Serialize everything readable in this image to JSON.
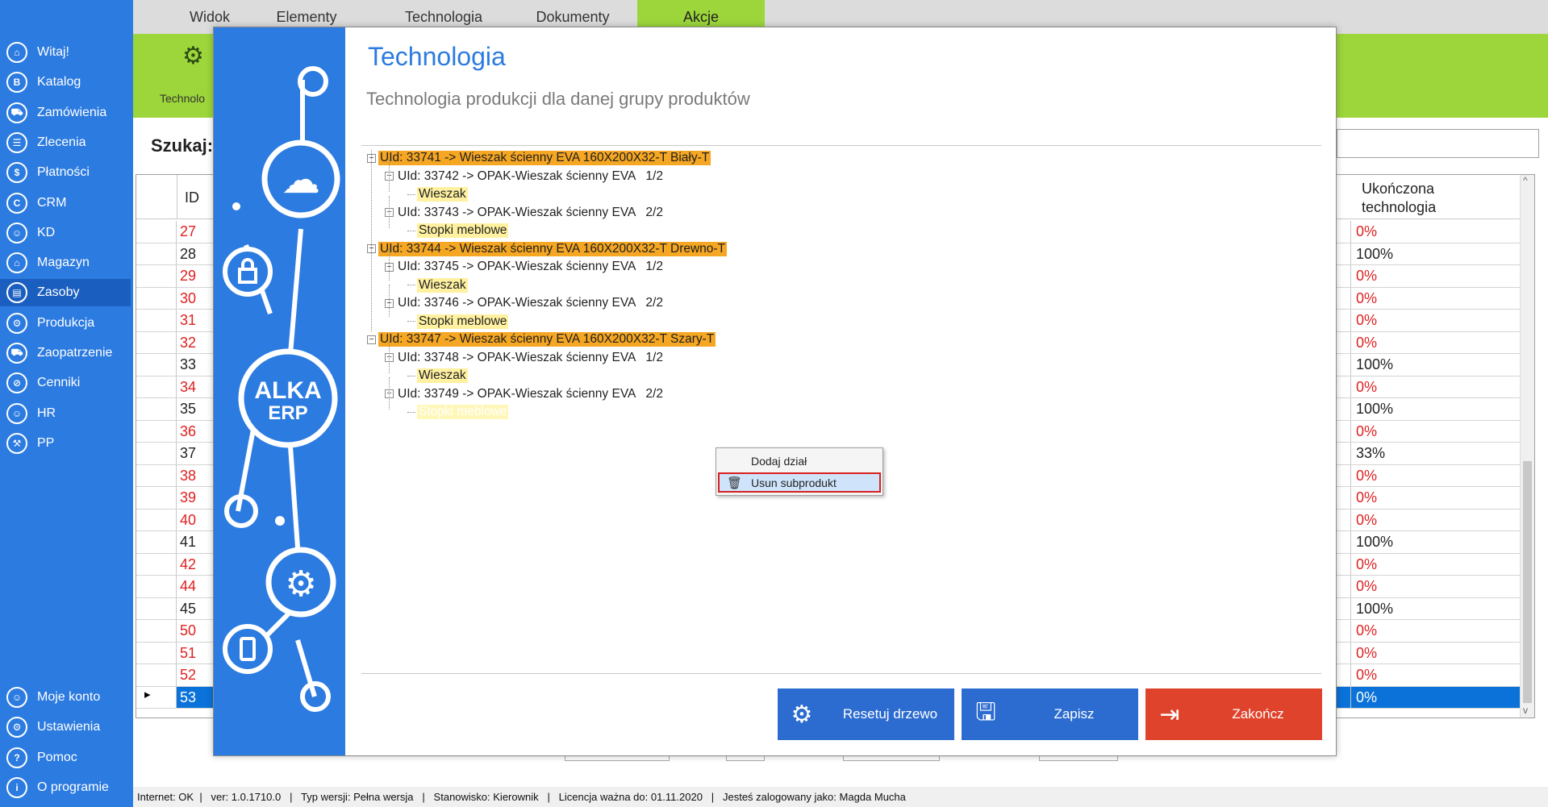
{
  "tabs": [
    {
      "label": "Widok",
      "active": false
    },
    {
      "label": "Elementy",
      "active": false
    },
    {
      "label": "Technologia",
      "active": false
    },
    {
      "label": "Dokumenty",
      "active": false
    },
    {
      "label": "Akcje",
      "active": true
    }
  ],
  "ribbon": {
    "label": "Technolo",
    "icon": "gears-icon"
  },
  "sidebar": {
    "items": [
      {
        "label": "Witaj!",
        "icon": "home-icon"
      },
      {
        "label": "Katalog",
        "icon": "book-icon"
      },
      {
        "label": "Zamówienia",
        "icon": "cart-icon"
      },
      {
        "label": "Zlecenia",
        "icon": "list-icon"
      },
      {
        "label": "Płatności",
        "icon": "dollar-icon"
      },
      {
        "label": "CRM",
        "icon": "crm-icon"
      },
      {
        "label": "KD",
        "icon": "user-icon"
      },
      {
        "label": "Magazyn",
        "icon": "warehouse-icon"
      },
      {
        "label": "Zasoby",
        "icon": "resources-icon",
        "active": true
      },
      {
        "label": "Produkcja",
        "icon": "production-icon"
      },
      {
        "label": "Zaopatrzenie",
        "icon": "truck-icon"
      },
      {
        "label": "Cenniki",
        "icon": "tag-icon"
      },
      {
        "label": "HR",
        "icon": "hr-icon"
      },
      {
        "label": "PP",
        "icon": "factory-icon"
      }
    ],
    "bottom_items": [
      {
        "label": "Moje konto",
        "icon": "account-icon"
      },
      {
        "label": "Ustawienia",
        "icon": "settings-icon"
      },
      {
        "label": "Pomoc",
        "icon": "help-icon"
      },
      {
        "label": "O programie",
        "icon": "info-icon"
      }
    ]
  },
  "search": {
    "label": "Szukaj:"
  },
  "grid": {
    "header_id": "ID",
    "header_tech": "Ukończona\ntechnologia",
    "rows": [
      {
        "id": "27",
        "tech": "0%",
        "red": true
      },
      {
        "id": "28",
        "tech": "100%",
        "red": false
      },
      {
        "id": "29",
        "tech": "0%",
        "red": true
      },
      {
        "id": "30",
        "tech": "0%",
        "red": true
      },
      {
        "id": "31",
        "tech": "0%",
        "red": true
      },
      {
        "id": "32",
        "tech": "0%",
        "red": true
      },
      {
        "id": "33",
        "tech": "100%",
        "red": false
      },
      {
        "id": "34",
        "tech": "0%",
        "red": true
      },
      {
        "id": "35",
        "tech": "100%",
        "red": false
      },
      {
        "id": "36",
        "tech": "0%",
        "red": true
      },
      {
        "id": "37",
        "tech": "33%",
        "red": false
      },
      {
        "id": "38",
        "tech": "0%",
        "red": true
      },
      {
        "id": "39",
        "tech": "0%",
        "red": true
      },
      {
        "id": "40",
        "tech": "0%",
        "red": true
      },
      {
        "id": "41",
        "tech": "100%",
        "red": false
      },
      {
        "id": "42",
        "tech": "0%",
        "red": true
      },
      {
        "id": "44",
        "tech": "0%",
        "red": true
      },
      {
        "id": "45",
        "tech": "100%",
        "red": false
      },
      {
        "id": "50",
        "tech": "0%",
        "red": true
      },
      {
        "id": "51",
        "tech": "0%",
        "red": true
      },
      {
        "id": "52",
        "tech": "0%",
        "red": true
      },
      {
        "id": "53",
        "tech": "0%",
        "red": false,
        "selected": true
      }
    ]
  },
  "dialog": {
    "title": "Technologia",
    "subtitle": "Technologia produkcji dla danej grupy produktów",
    "tree": [
      {
        "level": 0,
        "text": "UId: 33741 -> Wieszak ścienny EVA 160X200X32-T Biały-T"
      },
      {
        "level": 1,
        "text": "UId: 33742 -> OPAK-Wieszak ścienny EVA   1/2"
      },
      {
        "level": 2,
        "text": "Wieszak"
      },
      {
        "level": 1,
        "text": "UId: 33743 -> OPAK-Wieszak ścienny EVA   2/2"
      },
      {
        "level": 2,
        "text": "Stopki meblowe"
      },
      {
        "level": 0,
        "text": "UId: 33744 -> Wieszak ścienny EVA 160X200X32-T Drewno-T"
      },
      {
        "level": 1,
        "text": "UId: 33745 -> OPAK-Wieszak ścienny EVA   1/2"
      },
      {
        "level": 2,
        "text": "Wieszak"
      },
      {
        "level": 1,
        "text": "UId: 33746 -> OPAK-Wieszak ścienny EVA   2/2"
      },
      {
        "level": 2,
        "text": "Stopki meblowe"
      },
      {
        "level": 0,
        "text": "UId: 33747 -> Wieszak ścienny EVA 160X200X32-T Szary-T"
      },
      {
        "level": 1,
        "text": "UId: 33748 -> OPAK-Wieszak ścienny EVA   1/2"
      },
      {
        "level": 2,
        "text": "Wieszak"
      },
      {
        "level": 1,
        "text": "UId: 33749 -> OPAK-Wieszak ścienny EVA   2/2"
      },
      {
        "level": 2,
        "text": "Stopki meblowe",
        "ghost": true
      }
    ],
    "context_menu": {
      "add_label": "Dodaj dział",
      "remove_label": "Usun subprodukt"
    },
    "buttons": {
      "reset": "Resetuj drzewo",
      "save": "Zapisz",
      "close": "Zakończ"
    },
    "logo": {
      "line1": "ALKA",
      "line2": "ERP"
    }
  },
  "status": "Internet: OK  |   ver: 1.0.1710.0   |   Typ wersji: Pełna wersja   |   Stanowisko: Kierownik   |   Licencja ważna do: 01.11.2020   |   Jesteś zalogowany jako: Magda Mucha",
  "colors": {
    "accent": "#2c7be0",
    "green": "#9cd63a",
    "orange": "#f5a623",
    "red": "#e0432b"
  }
}
